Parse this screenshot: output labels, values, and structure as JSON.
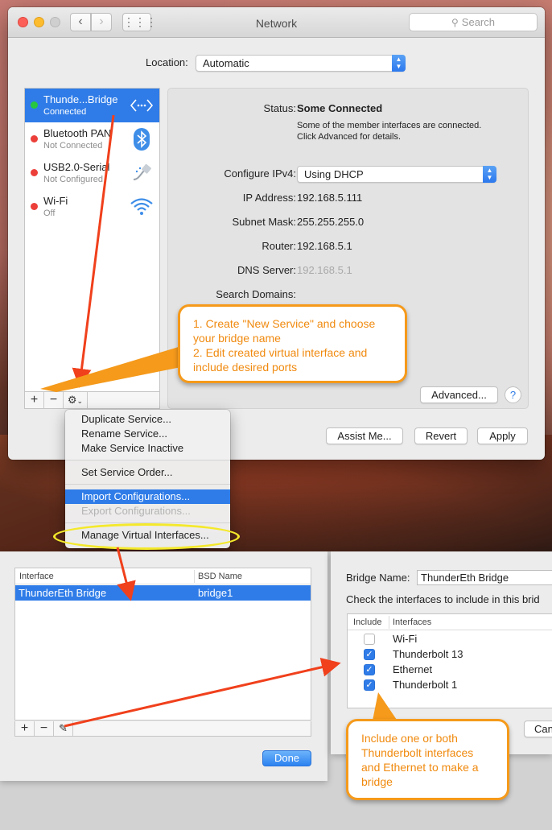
{
  "window": {
    "title": "Network",
    "search_placeholder": "Search"
  },
  "location": {
    "label": "Location:",
    "value": "Automatic"
  },
  "services": [
    {
      "name": "Thunde...Bridge",
      "status": "Connected",
      "status_color": "#27c840",
      "icon": "bridge-icon",
      "selected": true
    },
    {
      "name": "Bluetooth PAN",
      "status": "Not Connected",
      "status_color": "#ec3f3a",
      "icon": "bluetooth-icon",
      "selected": false
    },
    {
      "name": "USB2.0-Serial",
      "status": "Not Configured",
      "status_color": "#ec3f3a",
      "icon": "modem-icon",
      "selected": false
    },
    {
      "name": "Wi-Fi",
      "status": "Off",
      "status_color": "#ec3f3a",
      "icon": "wifi-icon",
      "selected": false
    }
  ],
  "sidebar_toolbar": {
    "add": "+",
    "remove": "−",
    "action": "⚙"
  },
  "detail": {
    "status_label": "Status:",
    "status_value": "Some Connected",
    "status_note_line1": "Some of the member interfaces are connected.",
    "status_note_line2": "Click Advanced for details.",
    "ipv4_label": "Configure IPv4:",
    "ipv4_value": "Using DHCP",
    "ip_label": "IP Address:",
    "ip_value": "192.168.5.111",
    "subnet_label": "Subnet Mask:",
    "subnet_value": "255.255.255.0",
    "router_label": "Router:",
    "router_value": "192.168.5.1",
    "dns_label": "DNS Server:",
    "dns_value": "192.168.5.1",
    "search_domains_label": "Search Domains:",
    "advanced_button": "Advanced...",
    "help_button": "?"
  },
  "footer_buttons": {
    "assist": "Assist Me...",
    "revert": "Revert",
    "apply": "Apply"
  },
  "context_menu": {
    "items": [
      {
        "label": "Duplicate Service...",
        "state": "normal"
      },
      {
        "label": "Rename Service...",
        "state": "normal"
      },
      {
        "label": "Make Service Inactive",
        "state": "normal"
      },
      {
        "label": "Set Service Order...",
        "state": "normal"
      },
      {
        "label": "Import Configurations...",
        "state": "highlighted"
      },
      {
        "label": "Export Configurations...",
        "state": "disabled"
      },
      {
        "label": "Manage Virtual Interfaces...",
        "state": "normal"
      }
    ]
  },
  "virtual_interfaces": {
    "columns": [
      "Interface",
      "BSD Name"
    ],
    "rows": [
      {
        "interface": "ThunderEth Bridge",
        "bsd_name": "bridge1"
      }
    ],
    "done_button": "Done"
  },
  "bridge_sheet": {
    "bridge_name_label": "Bridge Name:",
    "bridge_name_value": "ThunderEth Bridge",
    "instructions": "Check the interfaces to include in this brid",
    "columns": [
      "Include",
      "Interfaces"
    ],
    "interfaces": [
      {
        "name": "Wi-Fi",
        "checked": false
      },
      {
        "name": "Thunderbolt 13",
        "checked": true
      },
      {
        "name": "Ethernet",
        "checked": true
      },
      {
        "name": "Thunderbolt 1",
        "checked": true
      }
    ],
    "cancel_button": "Can"
  },
  "annotations": {
    "callout1_line1": "1. Create \"New Service\" and choose",
    "callout1_line2": "your bridge name",
    "callout1_line3": "2. Edit created virtual interface and",
    "callout1_line4": "include desired ports",
    "callout2_line1": "Include one or both",
    "callout2_line2": "Thunderbolt interfaces",
    "callout2_line3": "and Ethernet to make a",
    "callout2_line4": "bridge",
    "callout_color": "#f08a0f",
    "arrow_color": "#f0401c"
  }
}
